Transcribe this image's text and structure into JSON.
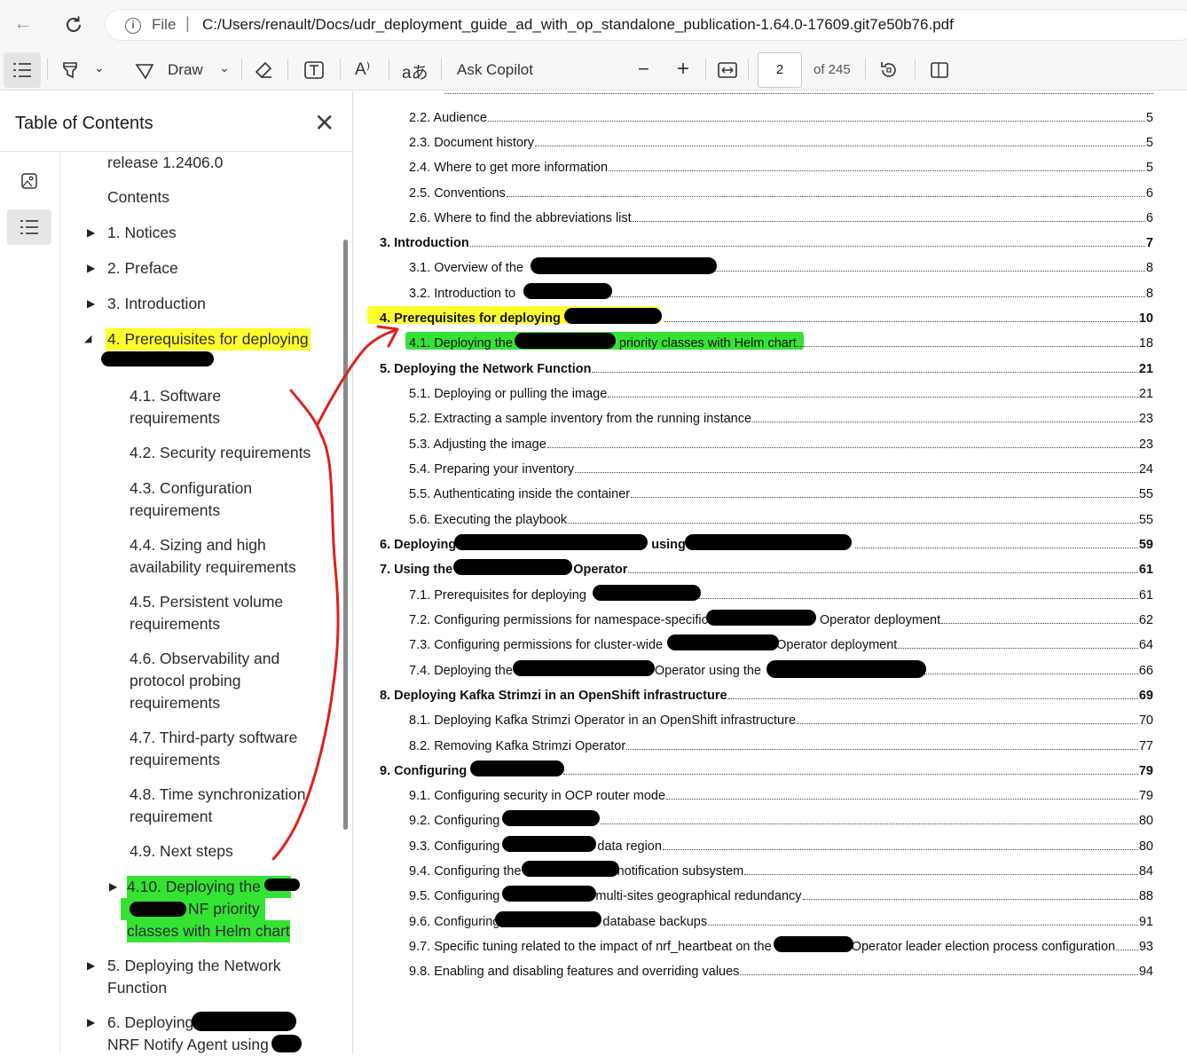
{
  "browser": {
    "url_scheme_label": "File",
    "url": "C:/Users/renault/Docs/udr_deployment_guide_ad_with_op_standalone_publication-1.64.0-17609.git7e50b76.pdf"
  },
  "toolbar": {
    "draw_label": "Draw",
    "ask_copilot_label": "Ask Copilot",
    "page_number": "2",
    "page_total": "of 245",
    "zoom_out": "−",
    "zoom_in": "+"
  },
  "toc": {
    "title": "Table of Contents",
    "items": [
      "release 1.2406.0",
      "Contents",
      "1. Notices",
      "2. Preface",
      "3. Introduction",
      "4. Prerequisites for deploying",
      "4.1. Software",
      "requirements",
      "4.2. Security requirements",
      "4.3. Configuration",
      "requirements",
      "4.4. Sizing and high",
      "availability requirements",
      "4.5. Persistent volume",
      "requirements",
      "4.6. Observability and",
      "protocol probing",
      "requirements",
      "4.7. Third-party software",
      "requirements",
      "4.8. Time synchronization",
      "requirement",
      "4.9. Next steps",
      "4.10. Deploying the",
      "NF priority",
      "classes with Helm chart",
      "5. Deploying the Network",
      "Function",
      "6. Deploying",
      "NRF Notify Agent using"
    ]
  },
  "doc": {
    "rows": [
      {
        "text": "2.2. Audience",
        "page": "5"
      },
      {
        "text": "2.3. Document history",
        "page": "5"
      },
      {
        "text": "2.4. Where to get more information",
        "page": "5"
      },
      {
        "text": "2.5. Conventions",
        "page": "6"
      },
      {
        "text": "2.6. Where to find the abbreviations list",
        "page": "6"
      },
      {
        "text": "3. Introduction",
        "page": "7"
      },
      {
        "text": "3.1. Overview of the",
        "page": "8"
      },
      {
        "text": "3.2. Introduction to",
        "page": "8"
      },
      {
        "text": "4. Prerequisites for deploying",
        "page": "10"
      },
      {
        "text": "4.1. Deploying the",
        "text2": "priority classes with Helm chart",
        "page": "18"
      },
      {
        "text": "5. Deploying the Network Function",
        "page": "21"
      },
      {
        "text": "5.1. Deploying or pulling the image",
        "page": "21"
      },
      {
        "text": "5.2. Extracting a sample inventory from the running instance",
        "page": "23"
      },
      {
        "text": "5.3. Adjusting the image",
        "page": "23"
      },
      {
        "text": "5.4. Preparing your inventory",
        "page": "24"
      },
      {
        "text": "5.5. Authenticating inside the container",
        "page": "55"
      },
      {
        "text": "5.6. Executing the playbook",
        "page": "55"
      },
      {
        "text": "6. Deploying",
        "text2": "using",
        "page": "59"
      },
      {
        "text": "7. Using the",
        "text2": "Operator",
        "page": "61"
      },
      {
        "text": "7.1. Prerequisites for deploying",
        "page": "61"
      },
      {
        "text": "7.2. Configuring permissions for namespace-specific",
        "text2": "Operator deployment",
        "page": "62"
      },
      {
        "text": "7.3. Configuring permissions for cluster-wide",
        "text2": "Operator deployment",
        "page": "64"
      },
      {
        "text": "7.4. Deploying the",
        "text2": "Operator using the",
        "page": "66"
      },
      {
        "text": "8. Deploying Kafka Strimzi in an OpenShift infrastructure",
        "page": "69"
      },
      {
        "text": "8.1. Deploying Kafka Strimzi Operator in an OpenShift infrastructure",
        "page": "70"
      },
      {
        "text": "8.2. Removing Kafka Strimzi Operator",
        "page": "77"
      },
      {
        "text": "9. Configuring",
        "page": "79"
      },
      {
        "text": "9.1. Configuring security in OCP router mode",
        "page": "79"
      },
      {
        "text": "9.2. Configuring",
        "page": "80"
      },
      {
        "text": "9.3. Configuring",
        "text2": "data region",
        "page": "80"
      },
      {
        "text": "9.4. Configuring the",
        "text2": "notification subsystem",
        "page": "84"
      },
      {
        "text": "9.5. Configuring",
        "text2": "multi-sites geographical redundancy",
        "page": "88"
      },
      {
        "text": "9.6. Configuring",
        "text2": "database backups",
        "page": "91"
      },
      {
        "text": "9.7. Specific tuning related to the impact of nrf_heartbeat on the",
        "text2": "Operator leader election process configuration",
        "page": "93"
      },
      {
        "text": "9.8. Enabling and disabling features and overriding values",
        "page": "94"
      }
    ]
  }
}
